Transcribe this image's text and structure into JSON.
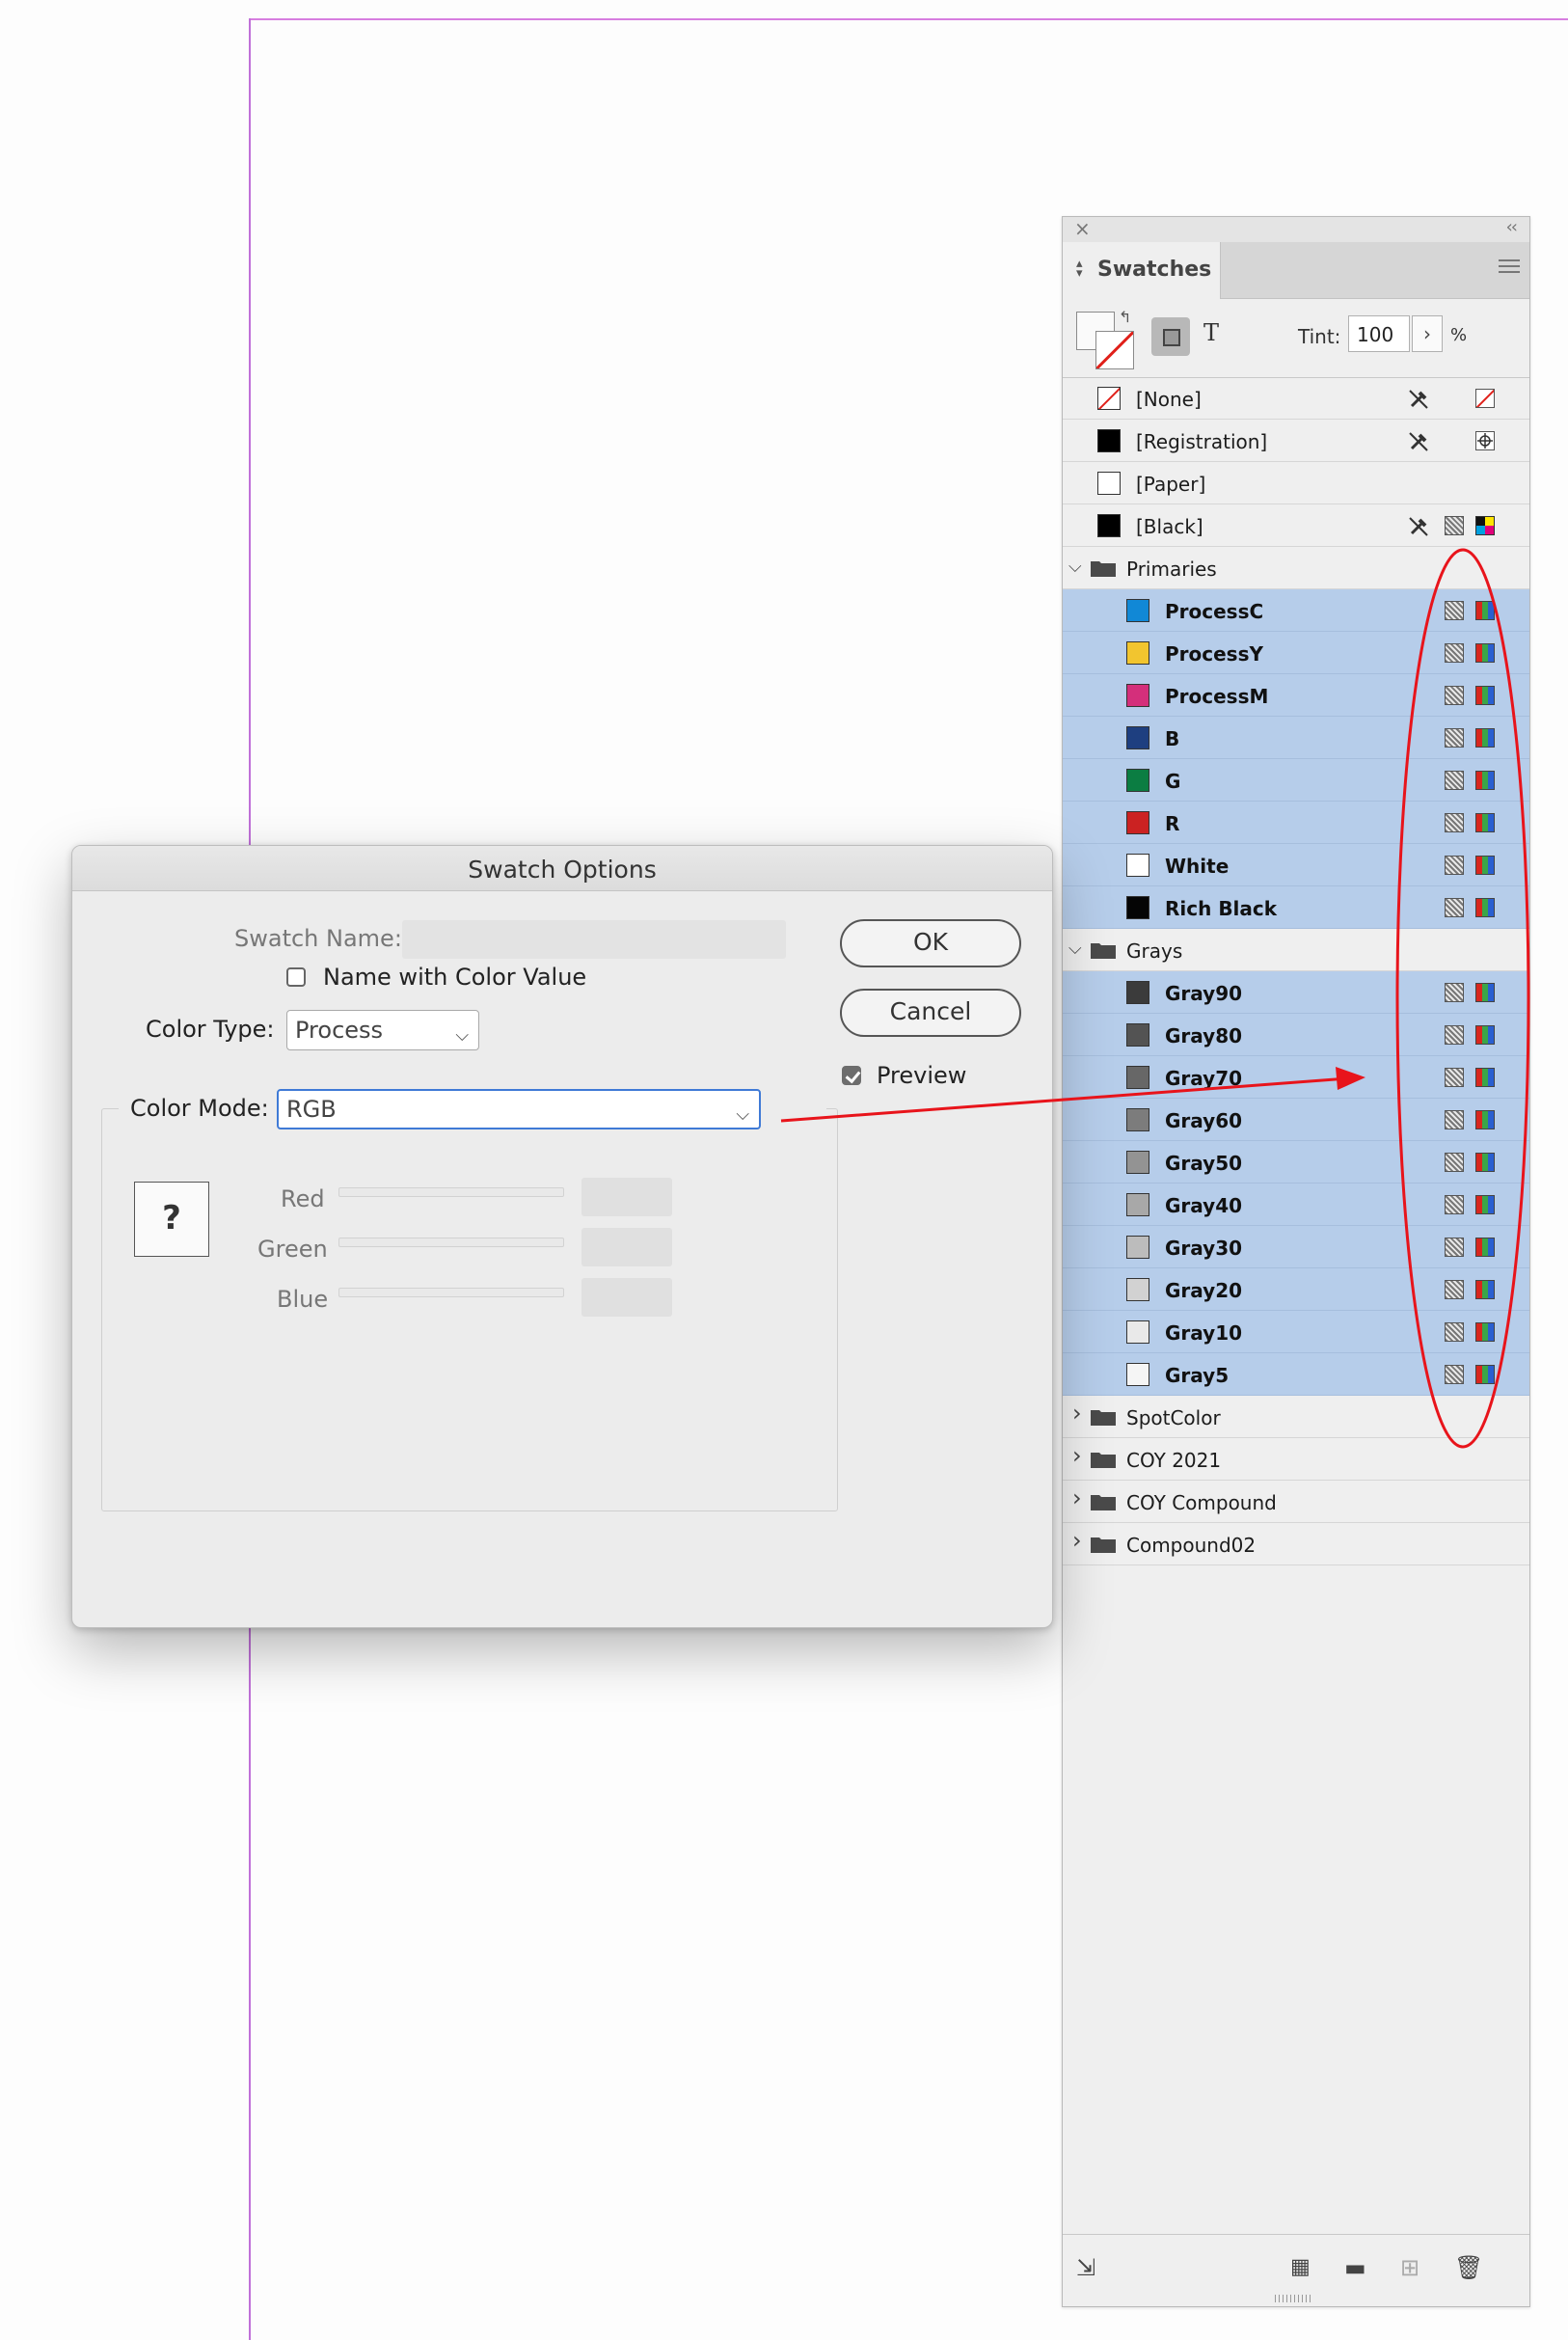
{
  "swatches_panel": {
    "tab_label": "Swatches",
    "tint_label": "Tint:",
    "tint_value": "100",
    "tint_unit": "%",
    "items": [
      {
        "name": "[None]",
        "chip": "none",
        "icons": [
          "noedit",
          "none"
        ]
      },
      {
        "name": "[Registration]",
        "chip": "#000000",
        "icons": [
          "noedit",
          "registration"
        ]
      },
      {
        "name": "[Paper]",
        "chip": "#ffffff",
        "icons": []
      },
      {
        "name": "[Black]",
        "chip": "#000000",
        "icons": [
          "noedit",
          "cmyk",
          "process"
        ]
      }
    ],
    "groups": [
      {
        "name": "Primaries",
        "expanded": true,
        "swatches": [
          {
            "name": "ProcessC",
            "color": "#1188d6"
          },
          {
            "name": "ProcessY",
            "color": "#f2c52f"
          },
          {
            "name": "ProcessM",
            "color": "#d42f7b"
          },
          {
            "name": "B",
            "color": "#1e3f80"
          },
          {
            "name": "G",
            "color": "#0b7d42"
          },
          {
            "name": "R",
            "color": "#cb2222"
          },
          {
            "name": "White",
            "color": "#ffffff"
          },
          {
            "name": "Rich Black",
            "color": "#050505"
          }
        ]
      },
      {
        "name": "Grays",
        "expanded": true,
        "swatches": [
          {
            "name": "Gray90",
            "color": "#3b3b3b"
          },
          {
            "name": "Gray80",
            "color": "#535353"
          },
          {
            "name": "Gray70",
            "color": "#676767"
          },
          {
            "name": "Gray60",
            "color": "#7c7c7c"
          },
          {
            "name": "Gray50",
            "color": "#939393"
          },
          {
            "name": "Gray40",
            "color": "#a8a8a8"
          },
          {
            "name": "Gray30",
            "color": "#bcbcbc"
          },
          {
            "name": "Gray20",
            "color": "#d2d2d2"
          },
          {
            "name": "Gray10",
            "color": "#e9e9e9"
          },
          {
            "name": "Gray5",
            "color": "#f5f5f5"
          }
        ]
      },
      {
        "name": "SpotColor",
        "expanded": false,
        "swatches": []
      },
      {
        "name": "COY 2021",
        "expanded": false,
        "swatches": []
      },
      {
        "name": "COY Compound",
        "expanded": false,
        "swatches": []
      },
      {
        "name": "Compound02",
        "expanded": false,
        "swatches": []
      }
    ]
  },
  "dialog": {
    "title": "Swatch Options",
    "swatch_name_label": "Swatch Name:",
    "swatch_name_value": "",
    "name_with_color_value_label": "Name with Color Value",
    "name_with_color_value_checked": false,
    "color_type_label": "Color Type:",
    "color_type_value": "Process",
    "color_mode_label": "Color Mode:",
    "color_mode_value": "RGB",
    "ok_label": "OK",
    "cancel_label": "Cancel",
    "preview_label": "Preview",
    "preview_checked": true,
    "mixed_indicator": "?",
    "channels": [
      {
        "label": "Red",
        "value": ""
      },
      {
        "label": "Green",
        "value": ""
      },
      {
        "label": "Blue",
        "value": ""
      }
    ]
  },
  "annotation": {
    "color": "#e8141b"
  }
}
